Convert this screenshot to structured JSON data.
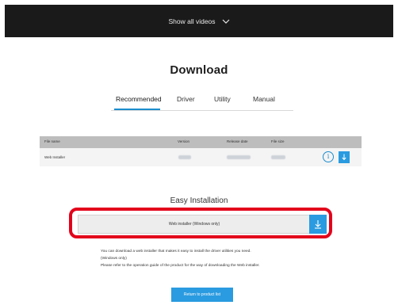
{
  "header": {
    "show_all_videos_label": "Show all videos",
    "chevron_icon": "chevron-down-icon"
  },
  "page": {
    "title": "Download"
  },
  "tabs": [
    {
      "label": "Recommended",
      "active": true
    },
    {
      "label": "Driver",
      "active": false
    },
    {
      "label": "Utility",
      "active": false
    },
    {
      "label": "Manual",
      "active": false
    }
  ],
  "table": {
    "headers": [
      "File name",
      "Version",
      "Release date",
      "File size"
    ],
    "rows": [
      {
        "file_name": "Web Installer",
        "version": "",
        "release_date": "",
        "file_size": ""
      }
    ],
    "info_icon": "info-icon",
    "download_icon": "download-arrow-icon"
  },
  "easy_installation": {
    "title": "Easy Installation",
    "web_installer_label": "Web installer (Windows only)",
    "description_lines": [
      "You can download a web installer that makes it easy to install the driver utilities you need.",
      "(Windows only)",
      "Please refer to the operation guide of the product for the way of downloading the Web installer."
    ]
  },
  "footer": {
    "return_label": "Return to product list"
  },
  "colors": {
    "accent": "#2a9be0",
    "highlight": "#e3001b",
    "topbar": "#1a1a1a"
  }
}
